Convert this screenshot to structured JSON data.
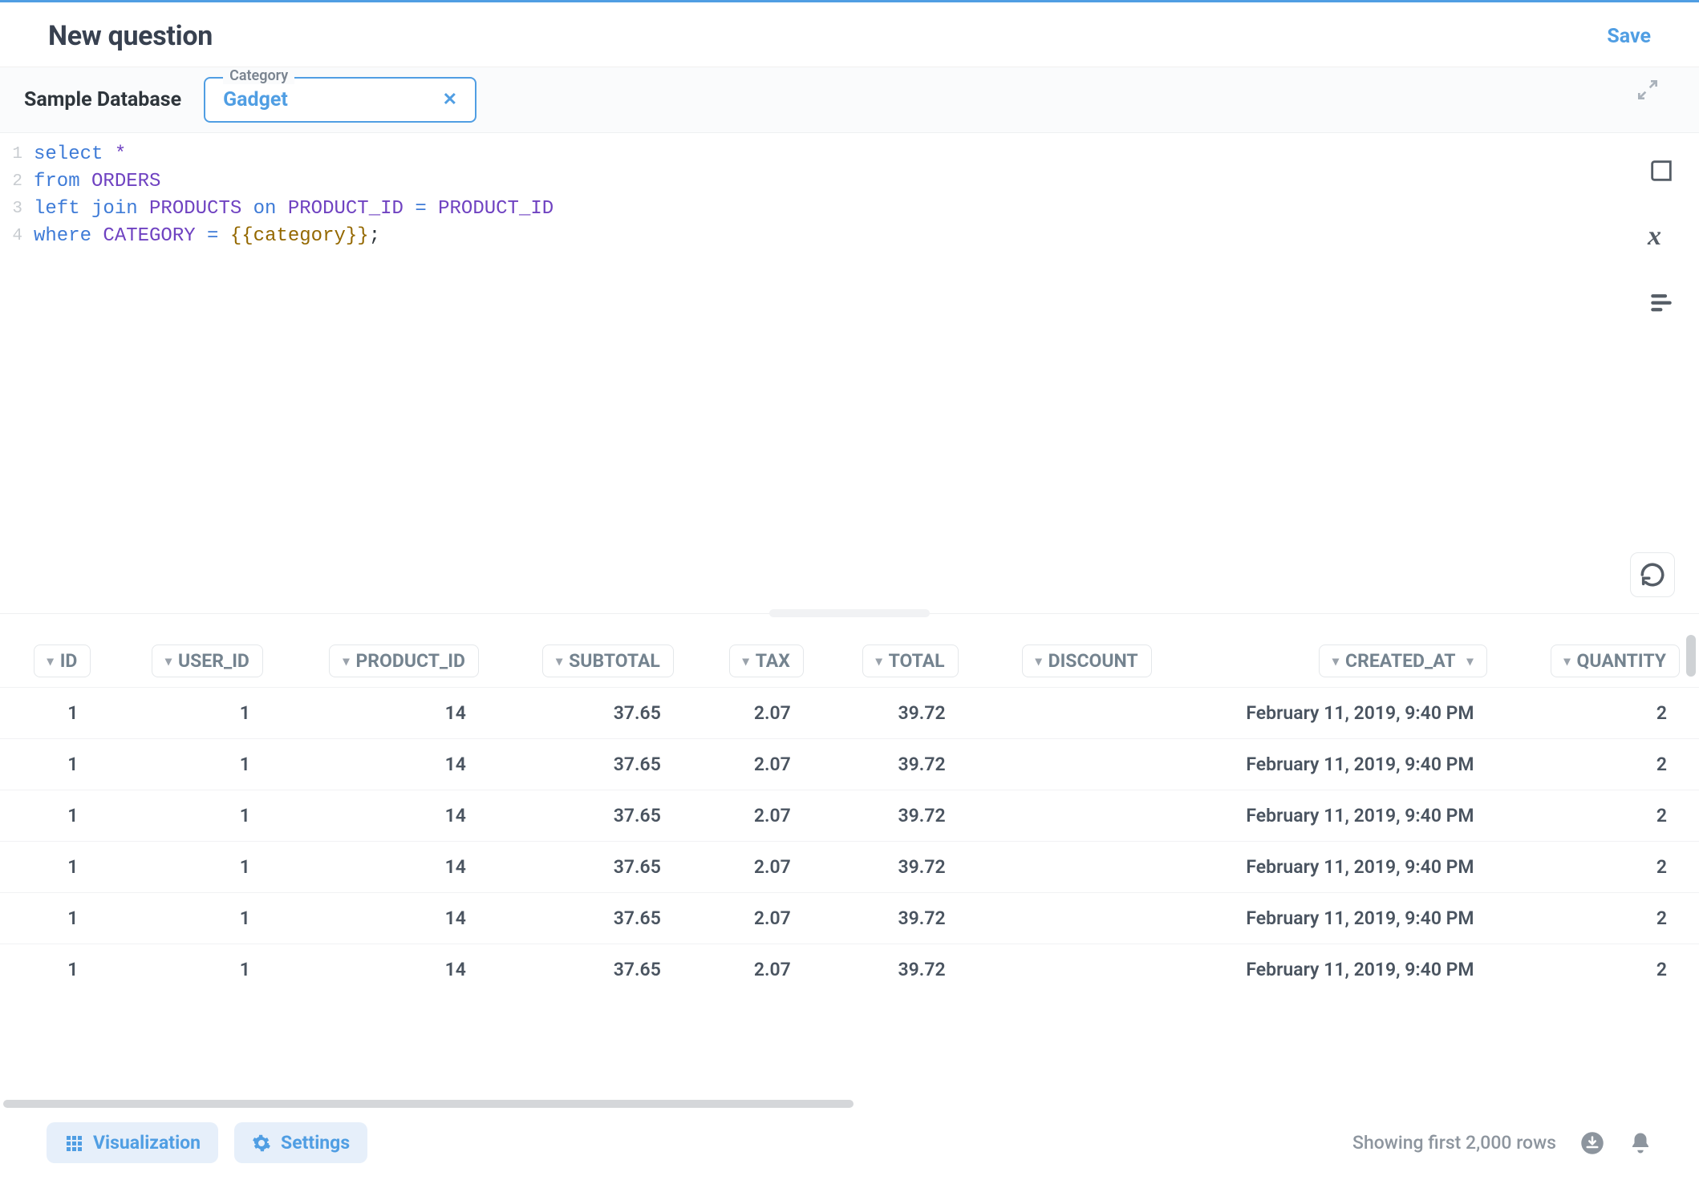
{
  "header": {
    "title": "New question",
    "save_label": "Save"
  },
  "filter_bar": {
    "database_name": "Sample Database",
    "chip": {
      "label": "Category",
      "value": "Gadget"
    }
  },
  "editor": {
    "lines": [
      {
        "n": "1",
        "tokens": [
          [
            "kw",
            "select"
          ],
          [
            "sp",
            " "
          ],
          [
            "star",
            "*"
          ]
        ]
      },
      {
        "n": "2",
        "tokens": [
          [
            "kw",
            "from"
          ],
          [
            "sp",
            " "
          ],
          [
            "ident",
            "ORDERS"
          ]
        ]
      },
      {
        "n": "3",
        "tokens": [
          [
            "kw",
            "left"
          ],
          [
            "sp",
            " "
          ],
          [
            "kw",
            "join"
          ],
          [
            "sp",
            " "
          ],
          [
            "ident",
            "PRODUCTS"
          ],
          [
            "sp",
            " "
          ],
          [
            "kw",
            "on"
          ],
          [
            "sp",
            " "
          ],
          [
            "ident",
            "PRODUCT_ID"
          ],
          [
            "sp",
            " "
          ],
          [
            "op",
            "="
          ],
          [
            "sp",
            " "
          ],
          [
            "ident",
            "PRODUCT_ID"
          ]
        ]
      },
      {
        "n": "4",
        "tokens": [
          [
            "kw",
            "where"
          ],
          [
            "sp",
            " "
          ],
          [
            "ident",
            "CATEGORY"
          ],
          [
            "sp",
            " "
          ],
          [
            "op",
            "="
          ],
          [
            "sp",
            " "
          ],
          [
            "tmpl",
            "{{category}}"
          ],
          [
            "punct",
            ";"
          ]
        ]
      }
    ]
  },
  "table": {
    "columns": [
      "ID",
      "USER_ID",
      "PRODUCT_ID",
      "SUBTOTAL",
      "TAX",
      "TOTAL",
      "DISCOUNT",
      "CREATED_AT",
      "QUANTITY"
    ],
    "rows": [
      {
        "ID": "1",
        "USER_ID": "1",
        "PRODUCT_ID": "14",
        "SUBTOTAL": "37.65",
        "TAX": "2.07",
        "TOTAL": "39.72",
        "DISCOUNT": "",
        "CREATED_AT": "February 11, 2019, 9:40 PM",
        "QUANTITY": "2"
      },
      {
        "ID": "1",
        "USER_ID": "1",
        "PRODUCT_ID": "14",
        "SUBTOTAL": "37.65",
        "TAX": "2.07",
        "TOTAL": "39.72",
        "DISCOUNT": "",
        "CREATED_AT": "February 11, 2019, 9:40 PM",
        "QUANTITY": "2"
      },
      {
        "ID": "1",
        "USER_ID": "1",
        "PRODUCT_ID": "14",
        "SUBTOTAL": "37.65",
        "TAX": "2.07",
        "TOTAL": "39.72",
        "DISCOUNT": "",
        "CREATED_AT": "February 11, 2019, 9:40 PM",
        "QUANTITY": "2"
      },
      {
        "ID": "1",
        "USER_ID": "1",
        "PRODUCT_ID": "14",
        "SUBTOTAL": "37.65",
        "TAX": "2.07",
        "TOTAL": "39.72",
        "DISCOUNT": "",
        "CREATED_AT": "February 11, 2019, 9:40 PM",
        "QUANTITY": "2"
      },
      {
        "ID": "1",
        "USER_ID": "1",
        "PRODUCT_ID": "14",
        "SUBTOTAL": "37.65",
        "TAX": "2.07",
        "TOTAL": "39.72",
        "DISCOUNT": "",
        "CREATED_AT": "February 11, 2019, 9:40 PM",
        "QUANTITY": "2"
      },
      {
        "ID": "1",
        "USER_ID": "1",
        "PRODUCT_ID": "14",
        "SUBTOTAL": "37.65",
        "TAX": "2.07",
        "TOTAL": "39.72",
        "DISCOUNT": "",
        "CREATED_AT": "February 11, 2019, 9:40 PM",
        "QUANTITY": "2"
      }
    ]
  },
  "footer": {
    "visualization_label": "Visualization",
    "settings_label": "Settings",
    "status": "Showing first 2,000 rows"
  }
}
